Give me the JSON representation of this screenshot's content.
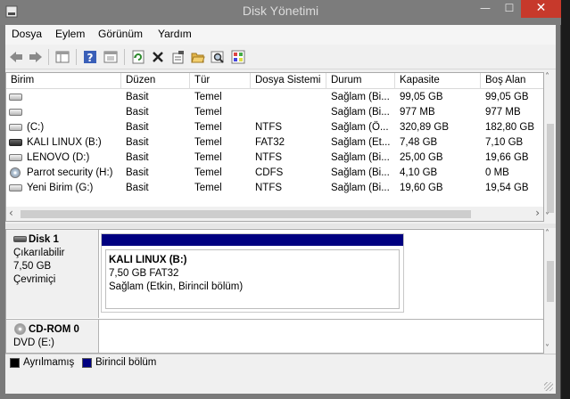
{
  "window": {
    "title": "Disk Yönetimi",
    "min_glyph": "—",
    "max_glyph": "☐",
    "close_glyph": "✕"
  },
  "menu": [
    "Dosya",
    "Eylem",
    "Görünüm",
    "Yardım"
  ],
  "toolbar": [
    "back-icon",
    "forward-icon",
    "console-tree-icon",
    "help-icon",
    "properties-view-icon",
    "refresh-icon",
    "delete-icon",
    "properties-icon",
    "open-icon",
    "explore-icon",
    "settings-icon"
  ],
  "volume_list": {
    "columns": [
      "Birim",
      "Düzen",
      "Tür",
      "Dosya Sistemi",
      "Durum",
      "Kapasite",
      "Boş Alan"
    ],
    "rows": [
      {
        "icon": "drive",
        "birim": "",
        "duzen": "Basit",
        "tur": "Temel",
        "fs": "",
        "durum": "Sağlam (Bi...",
        "kapasite": "99,05 GB",
        "bos": "99,05 GB"
      },
      {
        "icon": "drive",
        "birim": "",
        "duzen": "Basit",
        "tur": "Temel",
        "fs": "",
        "durum": "Sağlam (Bi...",
        "kapasite": "977 MB",
        "bos": "977 MB"
      },
      {
        "icon": "drive",
        "birim": "(C:)",
        "duzen": "Basit",
        "tur": "Temel",
        "fs": "NTFS",
        "durum": "Sağlam (Ö...",
        "kapasite": "320,89 GB",
        "bos": "182,80 GB"
      },
      {
        "icon": "usb",
        "birim": "KALI LINUX (B:)",
        "duzen": "Basit",
        "tur": "Temel",
        "fs": "FAT32",
        "durum": "Sağlam (Et...",
        "kapasite": "7,48 GB",
        "bos": "7,10 GB"
      },
      {
        "icon": "drive",
        "birim": "LENOVO (D:)",
        "duzen": "Basit",
        "tur": "Temel",
        "fs": "NTFS",
        "durum": "Sağlam (Bi...",
        "kapasite": "25,00 GB",
        "bos": "19,66 GB"
      },
      {
        "icon": "disc",
        "birim": "Parrot security (H:)",
        "duzen": "Basit",
        "tur": "Temel",
        "fs": "CDFS",
        "durum": "Sağlam (Bi...",
        "kapasite": "4,10 GB",
        "bos": "0 MB"
      },
      {
        "icon": "drive",
        "birim": "Yeni Birim (G:)",
        "duzen": "Basit",
        "tur": "Temel",
        "fs": "NTFS",
        "durum": "Sağlam (Bi...",
        "kapasite": "19,60 GB",
        "bos": "19,54 GB"
      }
    ]
  },
  "disks": [
    {
      "name": "Disk 1",
      "type": "Çıkarılabilir",
      "size": "7,50 GB",
      "state": "Çevrimiçi",
      "partition": {
        "label": "KALI LINUX  (B:)",
        "size_fs": "7,50 GB FAT32",
        "status": "Sağlam (Etkin, Birincil bölüm)"
      }
    },
    {
      "name": "CD-ROM 0",
      "type": "DVD (E:)"
    }
  ],
  "legend": [
    {
      "label": "Ayrılmamış",
      "color": "#000000"
    },
    {
      "label": "Birincil bölüm",
      "color": "#000080"
    }
  ],
  "scroll": {
    "left": "‹",
    "right": "›",
    "up": "˄",
    "down": "˅"
  }
}
